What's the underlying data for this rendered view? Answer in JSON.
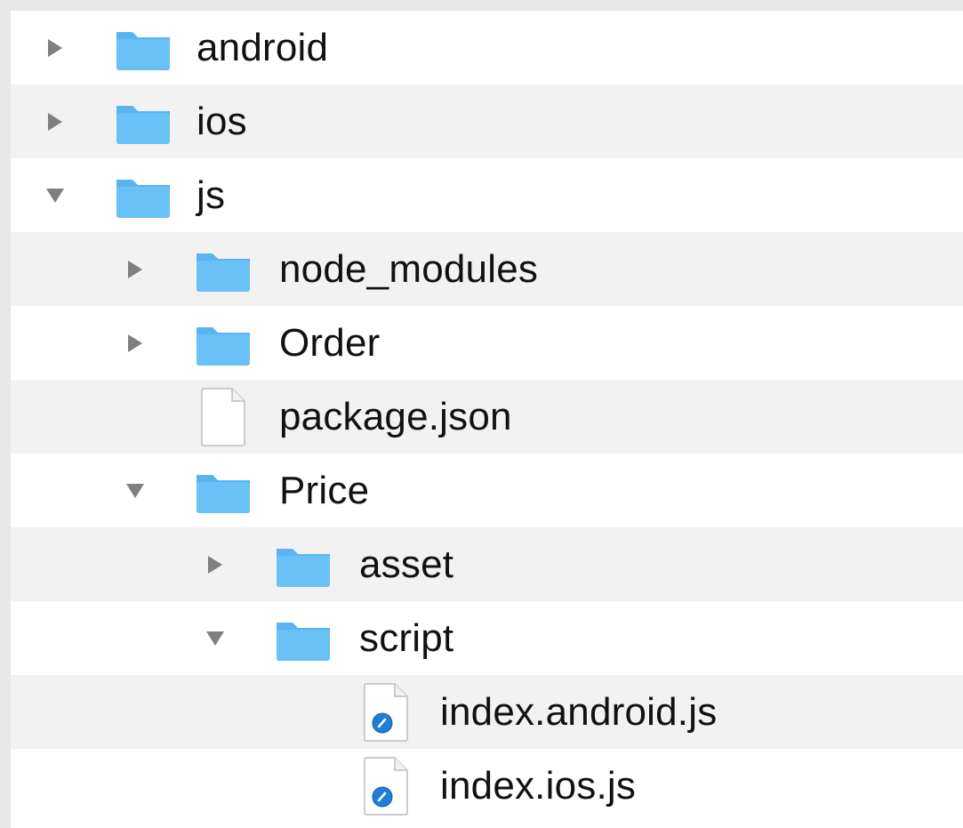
{
  "tree": {
    "rows": [
      {
        "label": "android",
        "kind": "folder",
        "expanded": false,
        "depth": 0
      },
      {
        "label": "ios",
        "kind": "folder",
        "expanded": false,
        "depth": 0
      },
      {
        "label": "js",
        "kind": "folder",
        "expanded": true,
        "depth": 0
      },
      {
        "label": "node_modules",
        "kind": "folder",
        "expanded": false,
        "depth": 1
      },
      {
        "label": "Order",
        "kind": "folder",
        "expanded": false,
        "depth": 1
      },
      {
        "label": "package.json",
        "kind": "file",
        "depth": 1
      },
      {
        "label": "Price",
        "kind": "folder",
        "expanded": true,
        "depth": 1
      },
      {
        "label": "asset",
        "kind": "folder",
        "expanded": false,
        "depth": 2
      },
      {
        "label": "script",
        "kind": "folder",
        "expanded": true,
        "depth": 2
      },
      {
        "label": "index.android.js",
        "kind": "js-file",
        "depth": 3
      },
      {
        "label": "index.ios.js",
        "kind": "js-file",
        "depth": 3
      }
    ]
  },
  "colors": {
    "folder": "#5ab4ef",
    "folder_tab": "#69c1f6",
    "disclosure": "#7f7f7f",
    "stripe": "#f2f2f2",
    "js_badge": "#1f7fd6"
  },
  "icons": {
    "folder": "folder-icon",
    "file": "file-icon",
    "js-file": "js-file-icon",
    "expanded": "disclosure-triangle-down-icon",
    "collapsed": "disclosure-triangle-right-icon"
  }
}
